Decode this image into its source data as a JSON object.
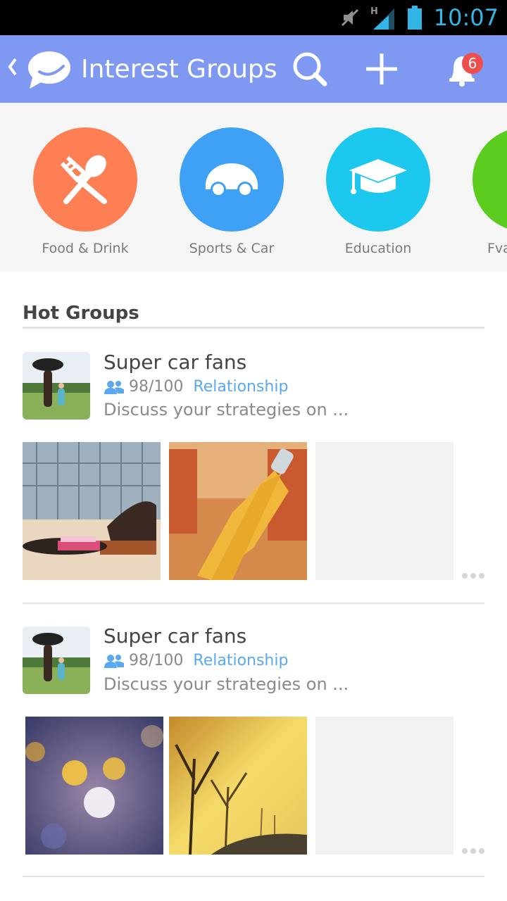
{
  "status_bar": {
    "time": "10:07",
    "network": "H"
  },
  "app_bar": {
    "back_icon": "chevron-left-icon",
    "title": "Interest Groups",
    "notification_count": "6"
  },
  "categories": [
    {
      "label": "Food & Drink",
      "icon": "utensils-icon",
      "color": "#ff7f55"
    },
    {
      "label": "Sports & Car",
      "icon": "car-icon",
      "color": "#3fa1f5"
    },
    {
      "label": "Education",
      "icon": "graduation-cap-icon",
      "color": "#1dc8ee"
    },
    {
      "label": "Fva",
      "icon": "category-icon",
      "color": "#5ccc1f"
    }
  ],
  "hot_groups": {
    "title": "Hot Groups",
    "items": [
      {
        "name": "Super car fans",
        "members": "98/100",
        "tag": "Relationship",
        "description": "Discuss your strategies on ..."
      },
      {
        "name": "Super car fans",
        "members": "98/100",
        "tag": "Relationship",
        "description": "Discuss your strategies on ..."
      }
    ]
  }
}
